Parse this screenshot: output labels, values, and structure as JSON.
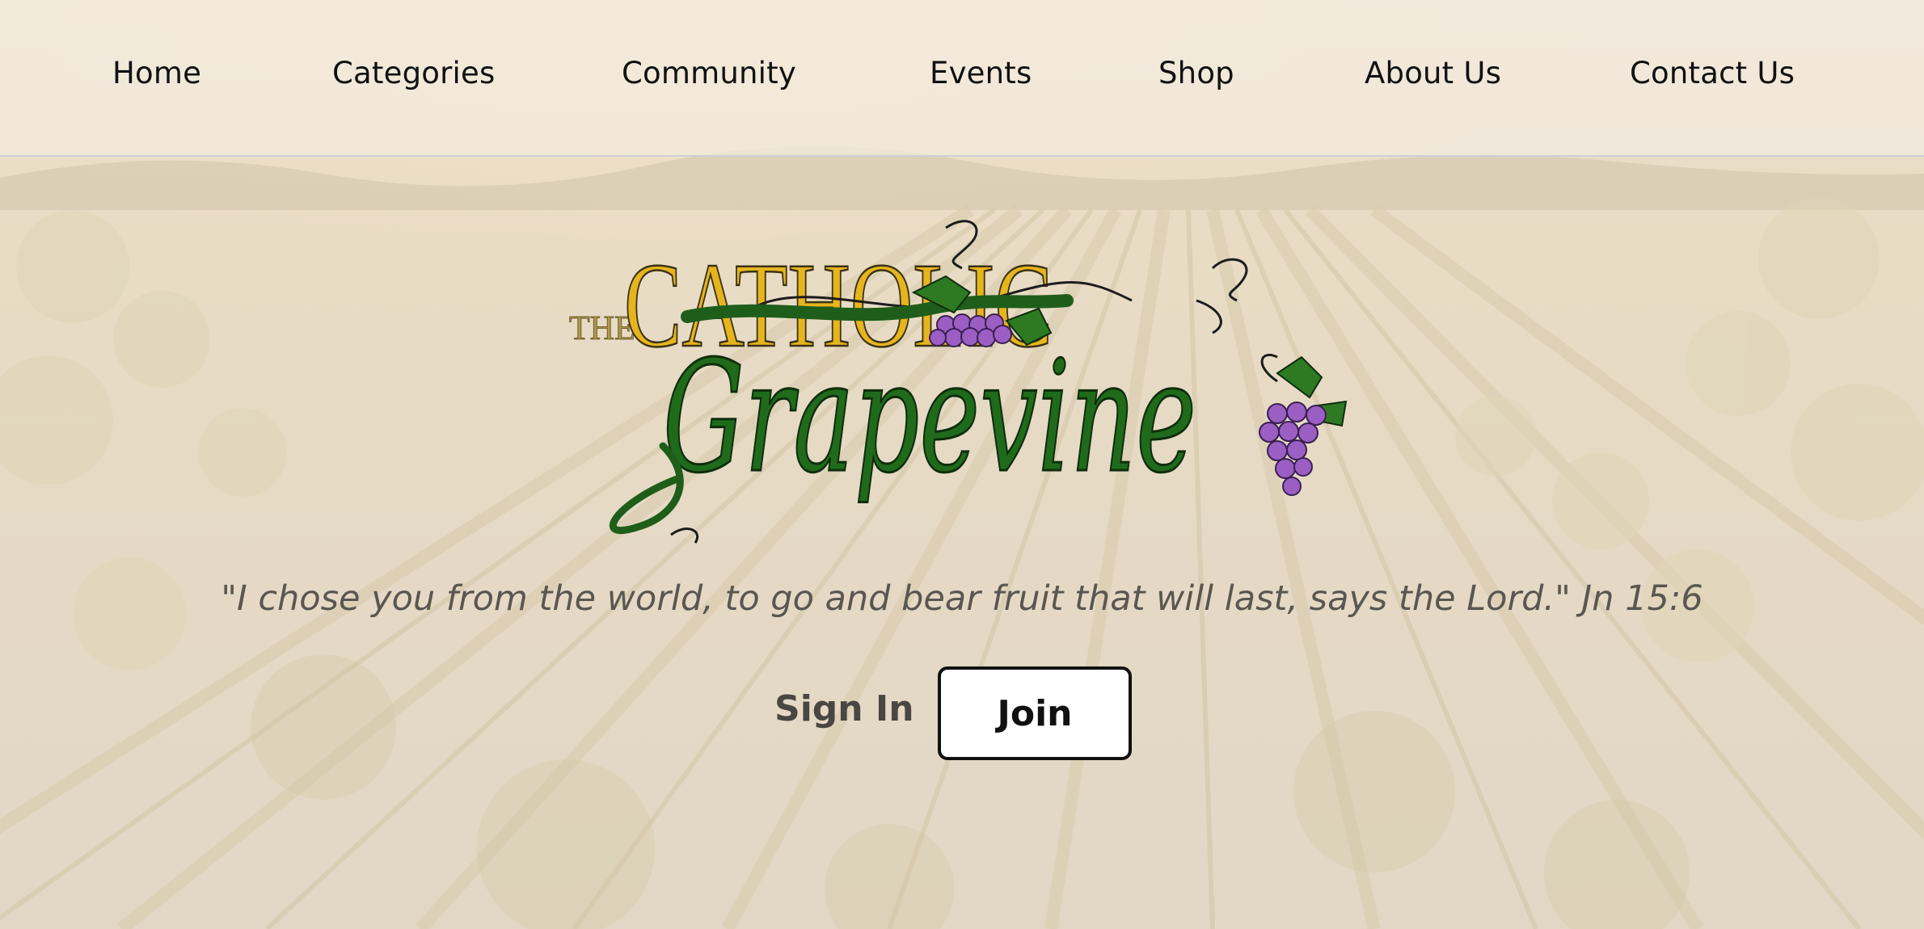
{
  "nav": {
    "items": [
      {
        "label": "Home"
      },
      {
        "label": "Categories"
      },
      {
        "label": "Community"
      },
      {
        "label": "Events"
      },
      {
        "label": "Shop"
      },
      {
        "label": "About Us"
      },
      {
        "label": "Contact Us"
      }
    ]
  },
  "logo": {
    "the": "THE",
    "catholic": "CATHOLIC",
    "grapevine": "Grapevine"
  },
  "hero": {
    "quote_open": "\"",
    "quote_text": "I chose you from the world, to go and bear fruit that will last, says the Lord.",
    "quote_close": "\"",
    "citation": " Jn 15:6"
  },
  "auth": {
    "signin_label": "Sign In",
    "join_label": "Join"
  },
  "colors": {
    "gold": "#e6b51e",
    "vine_green": "#1e5e1a",
    "grape_purple": "#9b5fc4",
    "background": "#e6dccb"
  }
}
